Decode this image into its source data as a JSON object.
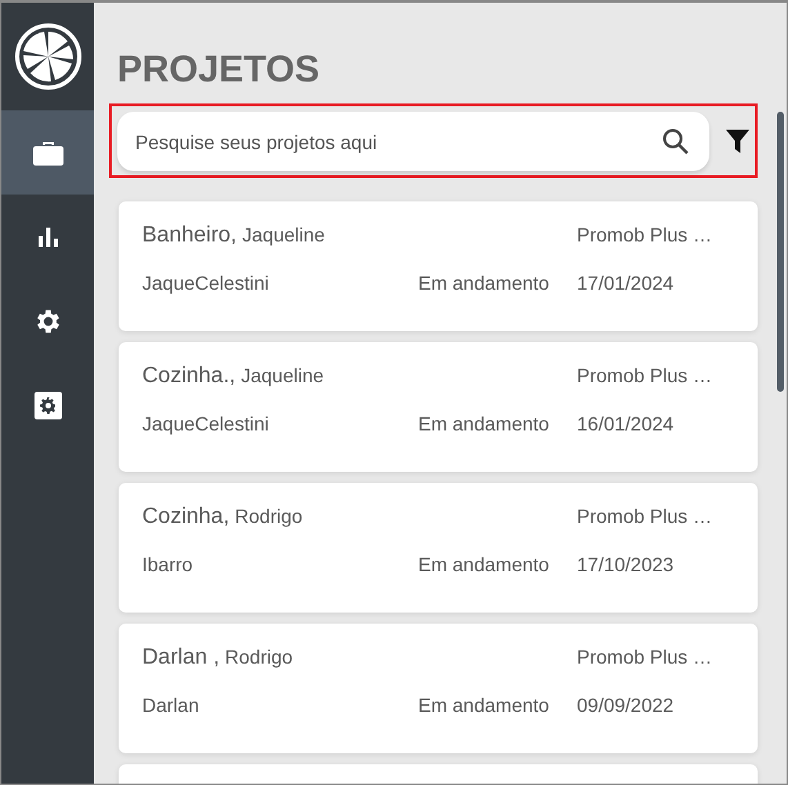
{
  "sidebar": {
    "items": [
      {
        "kind": "briefcase",
        "selected": true
      },
      {
        "kind": "chart",
        "selected": false
      },
      {
        "kind": "gear",
        "selected": false
      },
      {
        "kind": "gear-box",
        "selected": false
      }
    ]
  },
  "page": {
    "title": "PROJETOS"
  },
  "search": {
    "placeholder": "Pesquise seus projetos aqui"
  },
  "projects": [
    {
      "name": "Banheiro,",
      "client": "Jaqueline",
      "software": "Promob Plus …",
      "user": "JaqueCelestini",
      "status": "Em andamento",
      "date": "17/01/2024"
    },
    {
      "name": "Cozinha.,",
      "client": "Jaqueline",
      "software": "Promob Plus …",
      "user": "JaqueCelestini",
      "status": "Em andamento",
      "date": "16/01/2024"
    },
    {
      "name": "Cozinha,",
      "client": "Rodrigo",
      "software": "Promob Plus …",
      "user": "Ibarro",
      "status": "Em andamento",
      "date": "17/10/2023"
    },
    {
      "name": "Darlan ,",
      "client": "Rodrigo",
      "software": "Promob Plus …",
      "user": "Darlan",
      "status": "Em andamento",
      "date": "09/09/2022"
    }
  ]
}
